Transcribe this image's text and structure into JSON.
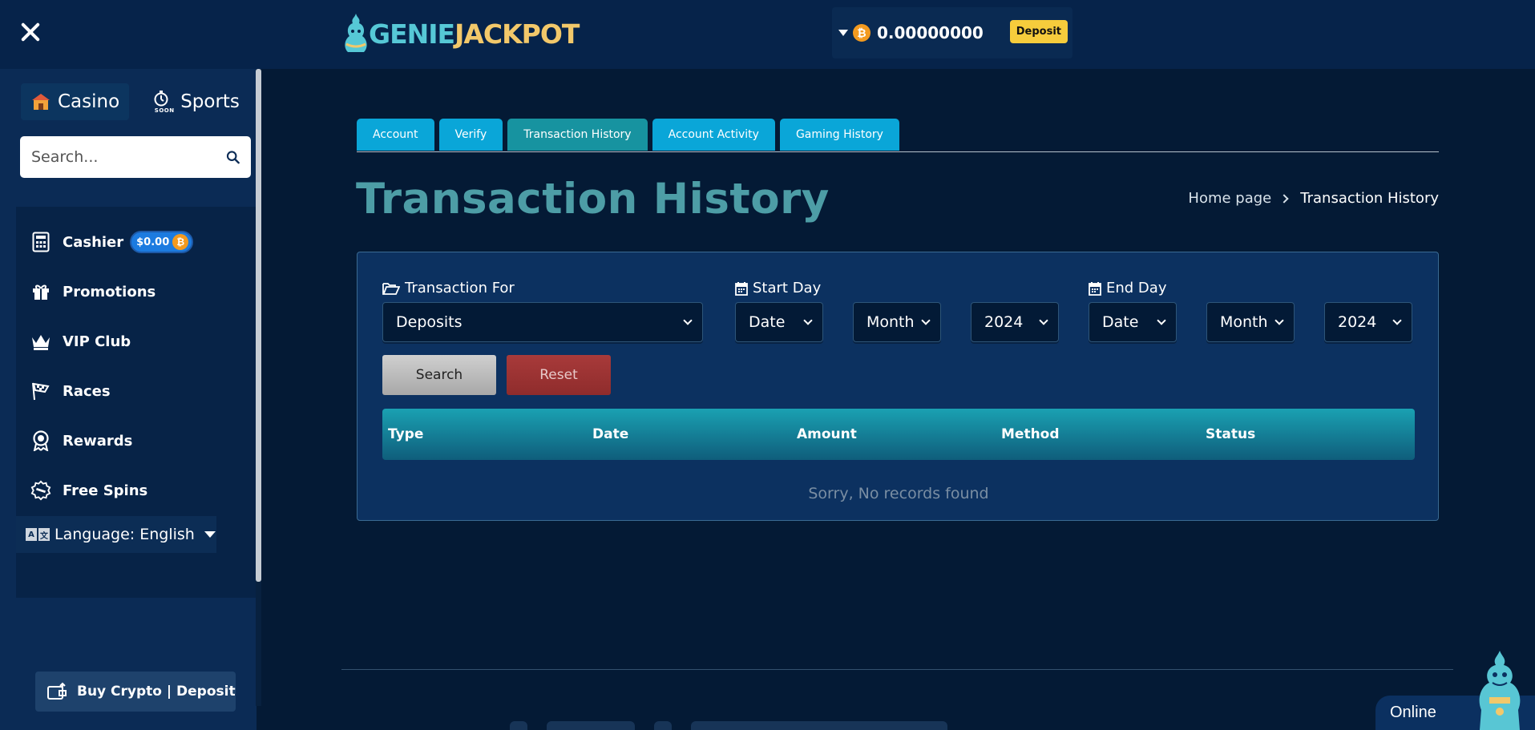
{
  "header": {
    "logo_left": "GENIE",
    "logo_right": "JACKPOT",
    "balance": "0.00000000",
    "balance_currency_symbol": "₿",
    "deposit_label": "Deposit"
  },
  "sidebar": {
    "tabs": [
      {
        "label": "Casino"
      },
      {
        "label": "Sports",
        "badge": "SOON"
      }
    ],
    "search_placeholder": "Search...",
    "items": [
      {
        "label": "Cashier",
        "badge": "$0.00",
        "icon": "calculator-icon"
      },
      {
        "label": "Promotions",
        "icon": "gift-icon"
      },
      {
        "label": "VIP Club",
        "icon": "crown-icon"
      },
      {
        "label": "Races",
        "icon": "race-flag-icon"
      },
      {
        "label": "Rewards",
        "icon": "award-badge-icon"
      },
      {
        "label": "Free Spins",
        "icon": "free-spins-icon"
      }
    ],
    "language_label": "Language: English",
    "language_icon_letters": [
      "A",
      "文"
    ],
    "buy_label": "Buy Crypto | Deposit"
  },
  "tabs": [
    {
      "label": "Account"
    },
    {
      "label": "Verify"
    },
    {
      "label": "Transaction History",
      "active": true
    },
    {
      "label": "Account Activity"
    },
    {
      "label": "Gaming History"
    }
  ],
  "page": {
    "title": "Transaction History",
    "breadcrumb_home": "Home page",
    "breadcrumb_current": "Transaction History"
  },
  "filters": {
    "transaction_for_label": "Transaction For",
    "transaction_for_value": "Deposits",
    "start_day_label": "Start Day",
    "end_day_label": "End Day",
    "start_date": "Date",
    "start_month": "Month",
    "start_year": "2024",
    "end_date": "Date",
    "end_month": "Month",
    "end_year": "2024",
    "search_label": "Search",
    "reset_label": "Reset"
  },
  "table": {
    "columns": [
      "Type",
      "Date",
      "Amount",
      "Method",
      "Status"
    ],
    "empty_message": "Sorry, No records found"
  },
  "chat": {
    "status": "Online"
  },
  "colors": {
    "background": "#041a35",
    "accent_tab": "#0aa6d8",
    "title": "#4d9da6",
    "deposit_button": "#f6cc3c",
    "bitcoin": "#f39a1f",
    "reset": "#a83a3a"
  }
}
